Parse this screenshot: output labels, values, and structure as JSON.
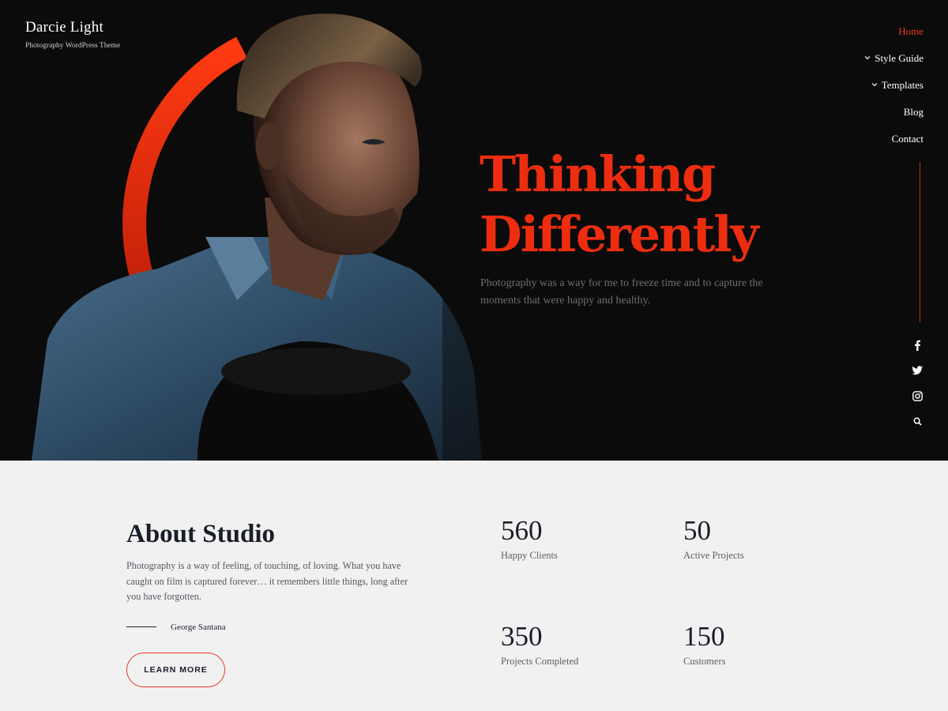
{
  "site": {
    "title": "Darcie Light",
    "tagline": "Photography WordPress Theme"
  },
  "nav": {
    "items": [
      {
        "label": "Home",
        "active": true,
        "has_dropdown": false
      },
      {
        "label": "Style Guide",
        "active": false,
        "has_dropdown": true
      },
      {
        "label": "Templates",
        "active": false,
        "has_dropdown": true
      },
      {
        "label": "Blog",
        "active": false,
        "has_dropdown": false
      },
      {
        "label": "Contact",
        "active": false,
        "has_dropdown": false
      }
    ]
  },
  "social": [
    "facebook-icon",
    "twitter-icon",
    "instagram-icon",
    "search-icon"
  ],
  "hero": {
    "heading_line1": "Thinking",
    "heading_line2": "Differently",
    "text": "Photography was a way for me to freeze time and to capture the moments that were happy and healthy."
  },
  "about": {
    "title_light": "About",
    "title_bold": "Studio",
    "text": "Photography is a way of feeling, of touching, of loving. What you have caught on film is captured forever… it remembers little things, long after you have forgotten.",
    "author": "George Santana",
    "button_label": "LEARN MORE"
  },
  "stats": [
    {
      "value": "560",
      "label": "Happy Clients"
    },
    {
      "value": "50",
      "label": "Active Projects"
    },
    {
      "value": "350",
      "label": "Projects Completed"
    },
    {
      "value": "150",
      "label": "Customers"
    }
  ],
  "colors": {
    "accent": "#ee2d10",
    "hero_bg": "#0b0b0b",
    "section_bg": "#f1f1f1",
    "dark_text": "#1a1d2a"
  }
}
